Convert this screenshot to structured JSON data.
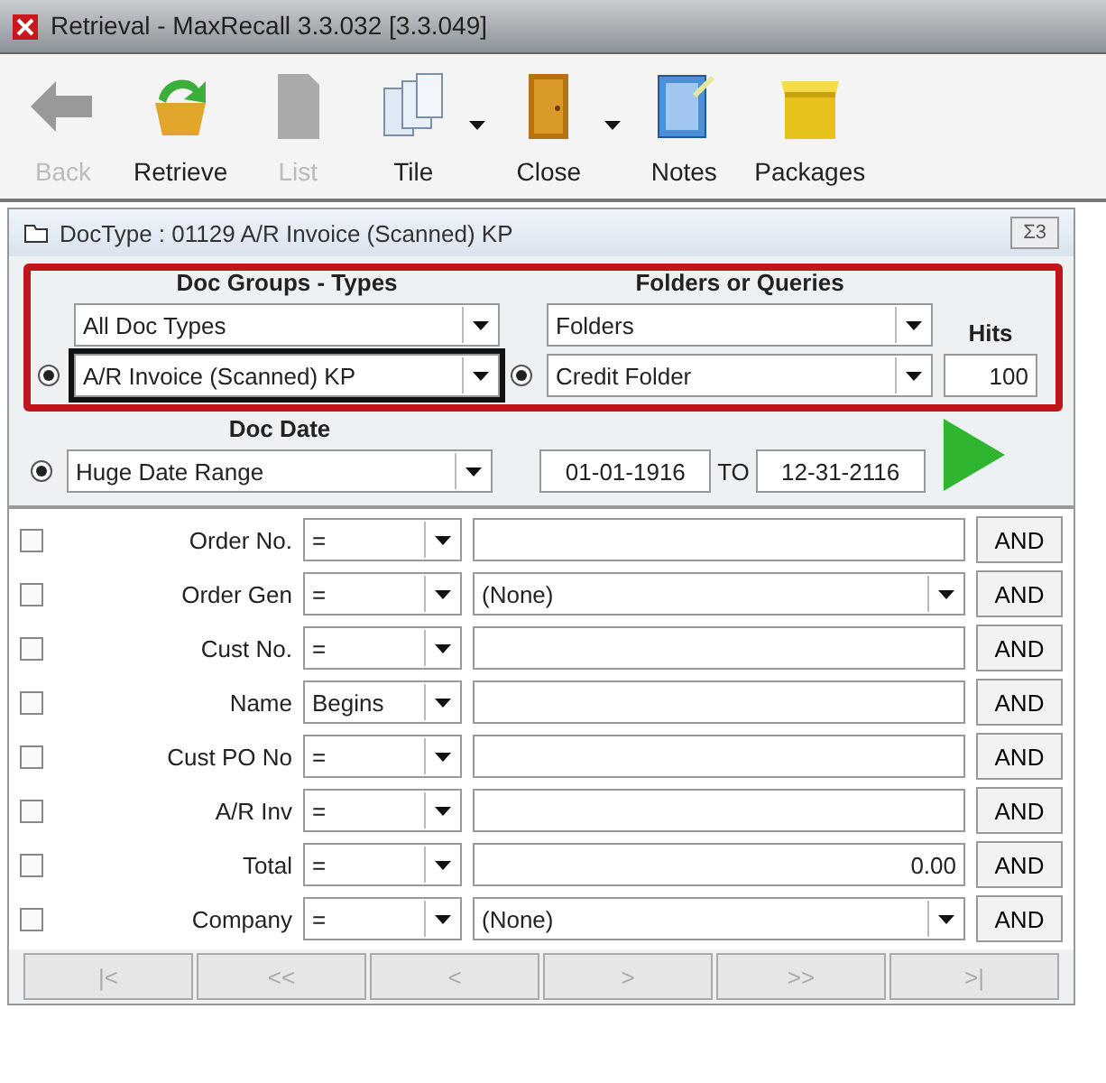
{
  "window": {
    "title": "Retrieval - MaxRecall 3.3.032 [3.3.049]"
  },
  "toolbar": [
    {
      "label": "Back",
      "kind": "back",
      "disabled": true,
      "dropdown": false
    },
    {
      "label": "Retrieve",
      "kind": "retrieve",
      "disabled": false,
      "dropdown": false
    },
    {
      "label": "List",
      "kind": "list",
      "disabled": true,
      "dropdown": false
    },
    {
      "label": "Tile",
      "kind": "tile",
      "disabled": false,
      "dropdown": true
    },
    {
      "label": "Close",
      "kind": "close",
      "disabled": false,
      "dropdown": true
    },
    {
      "label": "Notes",
      "kind": "notes",
      "disabled": false,
      "dropdown": false
    },
    {
      "label": "Packages",
      "kind": "packages",
      "disabled": false,
      "dropdown": false
    }
  ],
  "panel": {
    "title": "DocType :  01129 A/R Invoice (Scanned) KP",
    "close": "Σ3"
  },
  "groups": {
    "heading": "Doc Groups - Types",
    "group": "All Doc Types",
    "type": "A/R Invoice (Scanned) KP",
    "type_selected": true
  },
  "folders": {
    "heading": "Folders or Queries",
    "group": "Folders",
    "folder": "Credit Folder",
    "folder_selected": true
  },
  "hits": {
    "label": "Hits",
    "value": "100"
  },
  "date": {
    "heading": "Doc Date",
    "range": "Huge Date Range",
    "range_selected": true,
    "from": "01-01-1916",
    "to_label": "TO",
    "to": "12-31-2116"
  },
  "criteria": [
    {
      "label": "Order No.",
      "checked": false,
      "operator": "=",
      "kind": "text",
      "join": "AND"
    },
    {
      "label": "Order Gen",
      "checked": false,
      "operator": "=",
      "kind": "select",
      "value": "(None)",
      "join": "AND"
    },
    {
      "label": "Cust No.",
      "checked": false,
      "operator": "=",
      "kind": "text",
      "join": "AND"
    },
    {
      "label": "Name",
      "checked": false,
      "operator": "Begins",
      "kind": "text",
      "join": "AND"
    },
    {
      "label": "Cust PO No",
      "checked": false,
      "operator": "=",
      "kind": "text",
      "join": "AND"
    },
    {
      "label": "A/R Inv",
      "checked": false,
      "operator": "=",
      "kind": "text",
      "join": "AND"
    },
    {
      "label": "Total",
      "checked": false,
      "operator": "=",
      "kind": "text",
      "value": "0.00",
      "join": "AND"
    },
    {
      "label": "Company",
      "checked": false,
      "operator": "=",
      "kind": "select",
      "value": "(None)",
      "join": "AND"
    }
  ],
  "navigation": [
    {
      "label": "|<",
      "disabled": true
    },
    {
      "label": "<<",
      "disabled": true
    },
    {
      "label": "<",
      "disabled": true
    },
    {
      "label": ">",
      "disabled": true
    },
    {
      "label": ">>",
      "disabled": true
    },
    {
      "label": ">|",
      "disabled": true
    }
  ]
}
